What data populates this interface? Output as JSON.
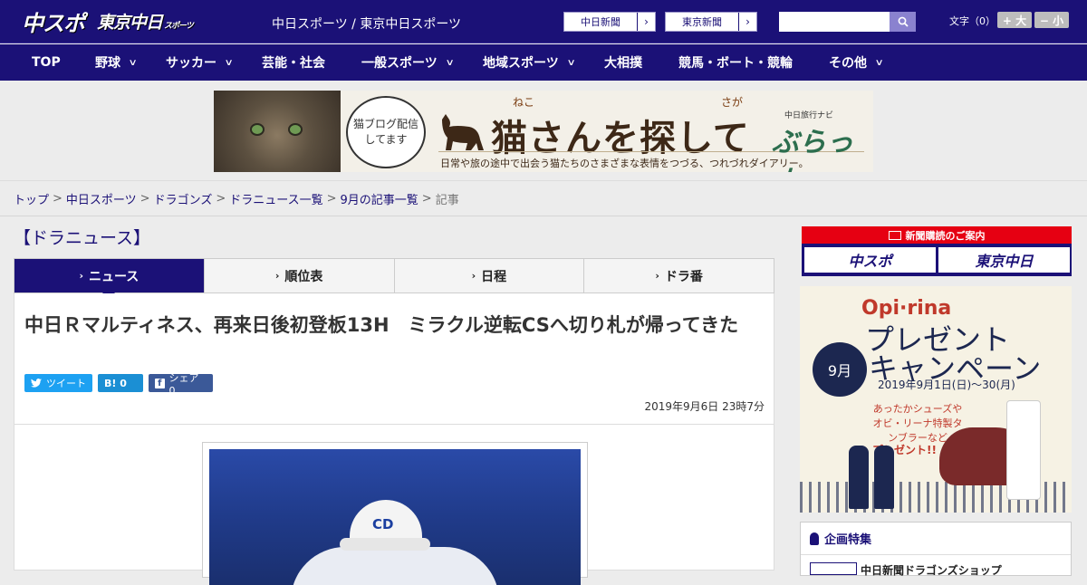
{
  "header": {
    "logo_main": "中スポ",
    "logo_sub": "東京中日",
    "logo_sub_small": "スポーツ",
    "site_name": "中日スポーツ / 東京中日スポーツ",
    "site_links": [
      "中日新聞",
      "東京新聞"
    ],
    "font_size_label": "文字（0）",
    "font_larger": "+ 大",
    "font_smaller": "− 小"
  },
  "nav": {
    "items": [
      {
        "label": "TOP",
        "chevron": false
      },
      {
        "label": "野球",
        "chevron": true
      },
      {
        "label": "サッカー",
        "chevron": true
      },
      {
        "label": "芸能・社会",
        "chevron": false
      },
      {
        "label": "一般スポーツ",
        "chevron": true
      },
      {
        "label": "地域スポーツ",
        "chevron": true
      },
      {
        "label": "大相撲",
        "chevron": false
      },
      {
        "label": "競馬・ボート・競輪",
        "chevron": false
      },
      {
        "label": "その他",
        "chevron": true
      }
    ]
  },
  "banner": {
    "bubble": "猫ブログ配信してます",
    "title": "猫さんを探して",
    "ruby1": "ねこ",
    "ruby2": "さが",
    "subtitle": "日常や旅の途中で出会う猫たちのさまざまな表情をつづる、つれづれダイアリー。",
    "navi": "中日旅行ナビ",
    "brand": "ぶらっ人"
  },
  "breadcrumb": {
    "links": [
      "トップ",
      "中日スポーツ",
      "ドラゴンズ",
      "ドラニュース一覧",
      "9月の記事一覧"
    ],
    "current": "記事",
    "separator": ">"
  },
  "main": {
    "section_title": "【ドラニュース】",
    "tabs": [
      {
        "label": "ニュース",
        "active": true
      },
      {
        "label": "順位表",
        "active": false
      },
      {
        "label": "日程",
        "active": false
      },
      {
        "label": "ドラ番",
        "active": false
      }
    ],
    "headline": "中日Ｒマルティネス、再来日後初登板13H　ミラクル逆転CSへ切り札が帰ってきた",
    "share": {
      "tweet": "ツイート",
      "hatena": "B! 0",
      "facebook": "シェア 0"
    },
    "date": "2019年9月6日 23時7分",
    "photo_cap_logo": "CD"
  },
  "sidebar": {
    "subscribe_header": "新聞購読のご案内",
    "subscribe_buttons": [
      "中スポ",
      "東京中日"
    ],
    "ad": {
      "brand": "Opi·rina",
      "title1": "プレゼント",
      "title2": "キャンペーン",
      "date": "2019年9月1日(日)〜30(月)",
      "month": "9月",
      "text": "あったかシューズやオビ・リーナ特製タンブラーなど",
      "text2": "プレゼント!!"
    },
    "feature_header": "企画特集",
    "feature_item": "中日新聞ドラゴンズショップ"
  },
  "colors": {
    "brand_navy": "#1b1177",
    "tweet_blue": "#1da1f2",
    "hatena_blue": "#1b8fd4",
    "facebook_blue": "#3b5998",
    "subscribe_red": "#e60012"
  }
}
